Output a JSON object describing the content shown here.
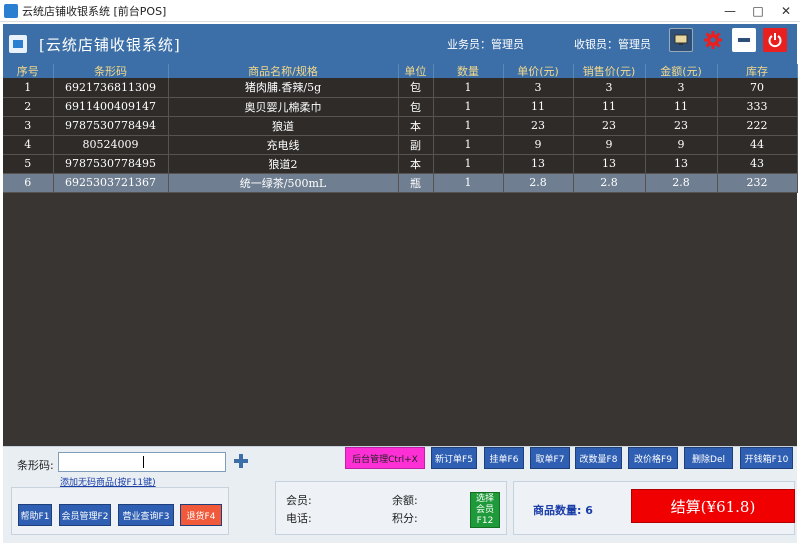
{
  "window": {
    "title": "云统店铺收银系统 [前台POS]",
    "min_label": "—",
    "max_label": "□",
    "close_label": "✕"
  },
  "header": {
    "system_title": "[云统店铺收银系统]",
    "salesperson": "业务员：管理员",
    "cashier": "收银员：管理员"
  },
  "table": {
    "columns": [
      "序号",
      "条形码",
      "商品名称/规格",
      "单位",
      "数量",
      "单价(元)",
      "销售价(元)",
      "金额(元)",
      "库存"
    ],
    "rows": [
      [
        "1",
        "6921736811309",
        "猪肉脯.香辣/5g",
        "包",
        "1",
        "3",
        "3",
        "3",
        "70"
      ],
      [
        "2",
        "6911400409147",
        "奥贝婴儿棉柔巾",
        "包",
        "1",
        "11",
        "11",
        "11",
        "333"
      ],
      [
        "3",
        "9787530778494",
        "狼道",
        "本",
        "1",
        "23",
        "23",
        "23",
        "222"
      ],
      [
        "4",
        "80524009",
        "充电线",
        "副",
        "1",
        "9",
        "9",
        "9",
        "44"
      ],
      [
        "5",
        "9787530778495",
        "狼道2",
        "本",
        "1",
        "13",
        "13",
        "13",
        "43"
      ],
      [
        "6",
        "6925303721367",
        "统一绿茶/500mL",
        "瓶",
        "1",
        "2.8",
        "2.8",
        "2.8",
        "232"
      ]
    ],
    "selected_row": 5
  },
  "barcode": {
    "label": "条形码:",
    "value": "",
    "add_link": "添加无码商品(按F11键)"
  },
  "actions": {
    "backend": "后台管理Ctrl+X",
    "new_order": "新订单F5",
    "hold": "挂单F6",
    "retrieve": "取单F7",
    "change_qty": "改数量F8",
    "change_price": "改价格F9",
    "delete": "删除Del",
    "open_drawer": "开钱箱F10"
  },
  "left_buttons": {
    "help": "帮助F1",
    "member_mgmt": "会员管理F2",
    "sales_query": "营业查询F3",
    "return": "退货F4"
  },
  "member": {
    "member_label": "会员:",
    "phone_label": "电话:",
    "balance_label": "余额:",
    "points_label": "积分:",
    "select_line1": "选择",
    "select_line2": "会员",
    "select_line3": "F12"
  },
  "summary": {
    "count_text": "商品数量: 6",
    "settle_text": "结算(¥61.8)"
  },
  "colors": {
    "header_bg": "#3c6fa7",
    "settle_bg": "#f00000",
    "backend_bg": "#ff2fd6"
  },
  "icons": {
    "app": "app-logo-icon",
    "screen": "monitor-icon",
    "settings": "gear-icon",
    "minimize": "minimize-icon",
    "power": "power-icon"
  }
}
